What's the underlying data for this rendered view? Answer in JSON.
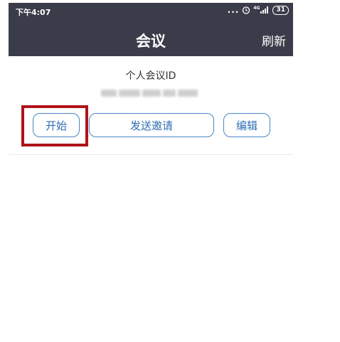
{
  "status_bar": {
    "time": "下午4:07",
    "dots": "...",
    "network": "4G",
    "battery": "31"
  },
  "nav": {
    "title": "会议",
    "refresh_label": "刷新"
  },
  "meeting": {
    "pmi_label": "个人会议ID"
  },
  "actions": {
    "start_label": "开始",
    "invite_label": "发送邀请",
    "edit_label": "编辑"
  },
  "colors": {
    "header_bg": "#3b3c4a",
    "button_border": "#4a86c6",
    "button_text": "#2f6fb5",
    "highlight": "#b0121a"
  },
  "icons": {
    "alarm": "alarm-icon",
    "signal": "signal-icon",
    "battery": "battery-icon"
  }
}
